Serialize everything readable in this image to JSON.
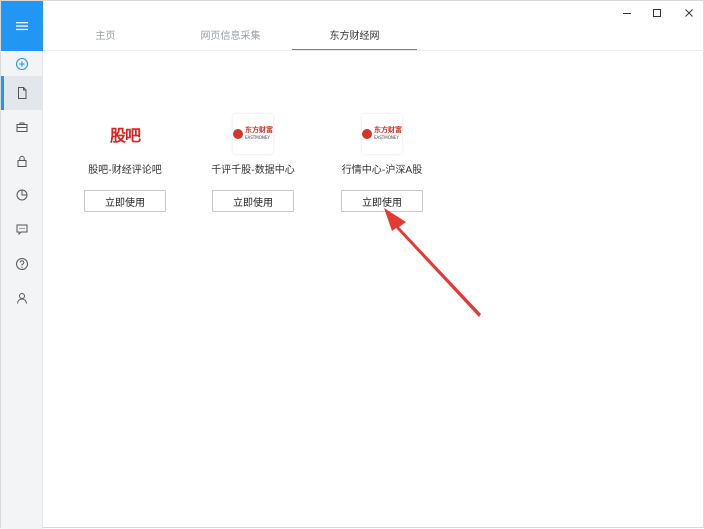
{
  "tabs": [
    {
      "label": "主页"
    },
    {
      "label": "网页信息采集"
    },
    {
      "label": "东方财经网"
    }
  ],
  "cards": [
    {
      "logo_text": "股吧",
      "name": "股吧-财经评论吧",
      "button_label": "立即使用"
    },
    {
      "logo_text": "东方财富",
      "logo_subtext": "EASTMONEY",
      "name": "千评千股-数据中心",
      "button_label": "立即使用"
    },
    {
      "logo_text": "东方财富",
      "logo_subtext": "EASTMONEY",
      "name": "行情中心-沪深A股",
      "button_label": "立即使用"
    }
  ],
  "sidebar": {
    "items": [
      {
        "icon": "add-circle-icon"
      },
      {
        "icon": "document-icon",
        "active": true
      },
      {
        "icon": "briefcase-icon"
      },
      {
        "icon": "lock-icon"
      },
      {
        "icon": "pie-chart-icon"
      },
      {
        "icon": "chat-icon"
      },
      {
        "icon": "help-icon"
      },
      {
        "icon": "user-icon"
      }
    ]
  },
  "colors": {
    "accent": "#2196f3",
    "annotation_arrow": "#e53935",
    "guba_logo": "#e02020"
  }
}
